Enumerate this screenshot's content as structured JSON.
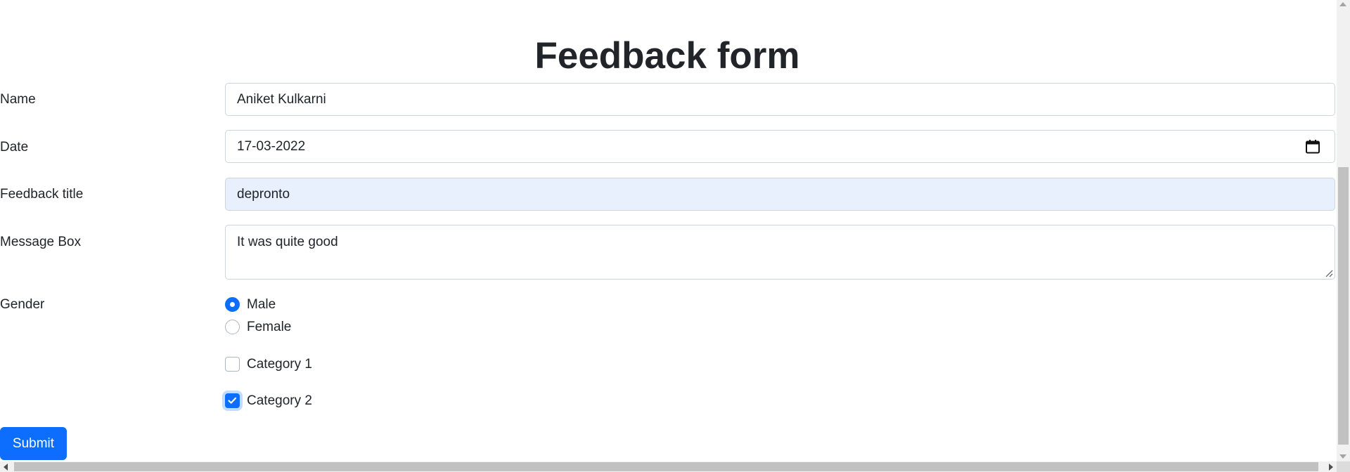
{
  "form": {
    "title": "Feedback form",
    "name": {
      "label": "Name",
      "value": "Aniket Kulkarni"
    },
    "date": {
      "label": "Date",
      "value": "17-03-2022"
    },
    "feedback_title": {
      "label": "Feedback title",
      "value": "depronto"
    },
    "message": {
      "label": "Message Box",
      "value": "It was quite good"
    },
    "gender": {
      "label": "Gender",
      "options": [
        {
          "label": "Male",
          "checked": true
        },
        {
          "label": "Female",
          "checked": false
        }
      ]
    },
    "categories": [
      {
        "label": "Category 1",
        "checked": false
      },
      {
        "label": "Category 2",
        "checked": true
      }
    ],
    "submit_label": "Submit"
  },
  "colors": {
    "primary": "#0d6efd",
    "autofill_bg": "#e8f0fe",
    "border": "#ced4da",
    "text": "#212529"
  },
  "icons": {
    "date_picker": "calendar-icon",
    "textarea_resize": "resize-handle-icon"
  }
}
